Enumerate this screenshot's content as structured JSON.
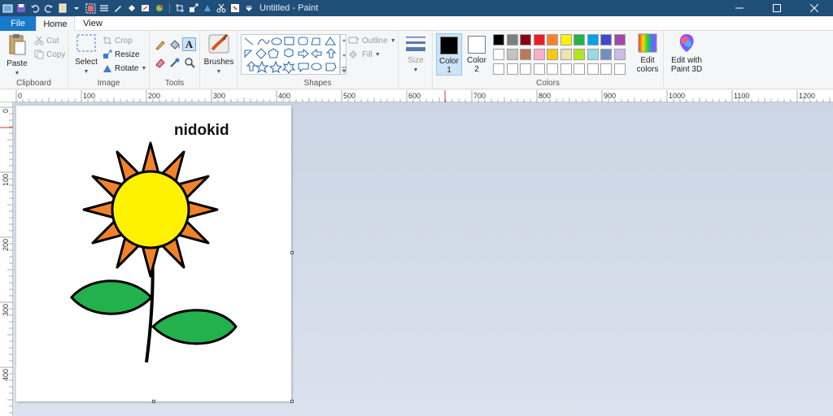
{
  "titlebar": {
    "title": "Untitled - Paint",
    "quick_access": [
      "app-icon",
      "save-icon",
      "undo-icon",
      "redo-icon",
      "clipboard-icon",
      "dropdown-icon",
      "select-icon",
      "size-icon",
      "pencil-icon",
      "fill-icon",
      "brush-icon",
      "paint3d-icon",
      "crop-icon",
      "resize-icon",
      "rotate-icon",
      "cut-icon",
      "color-picker-icon",
      "customize-icon"
    ]
  },
  "tabs": {
    "file": "File",
    "home": "Home",
    "view": "View"
  },
  "ribbon": {
    "clipboard": {
      "label": "Clipboard",
      "paste": "Paste",
      "cut": "Cut",
      "copy": "Copy"
    },
    "image": {
      "label": "Image",
      "select": "Select",
      "crop": "Crop",
      "resize": "Resize",
      "rotate": "Rotate"
    },
    "tools": {
      "label": "Tools",
      "brushes": "Brushes"
    },
    "shapes": {
      "label": "Shapes",
      "outline": "Outline",
      "fill": "Fill"
    },
    "size": {
      "label": "Size"
    },
    "colors": {
      "label": "Colors",
      "color1": "Color",
      "color1_num": "1",
      "color2": "Color",
      "color2_num": "2",
      "color1_value": "#000000",
      "color2_value": "#ffffff",
      "edit_colors_line1": "Edit",
      "edit_colors_line2": "colors",
      "palette_row1": [
        "#000000",
        "#7f7f7f",
        "#880015",
        "#ed1c24",
        "#ff7f27",
        "#fff200",
        "#22b14c",
        "#00a2e8",
        "#3f48cc",
        "#a349a4"
      ],
      "palette_row2": [
        "#ffffff",
        "#c3c3c3",
        "#b97a57",
        "#ffaec9",
        "#ffc90e",
        "#efe4b0",
        "#b5e61d",
        "#99d9ea",
        "#7092be",
        "#c8bfe7"
      ]
    },
    "paint3d": {
      "line1": "Edit with",
      "line2": "Paint 3D"
    }
  },
  "ruler": {
    "top_labels": [
      "0",
      "100",
      "200",
      "300",
      "400",
      "500",
      "600",
      "700",
      "800",
      "900",
      "1000",
      "1100",
      "1200"
    ],
    "left_labels": [
      "0",
      "100",
      "200",
      "300",
      "400"
    ]
  },
  "canvas": {
    "text": "nidokid",
    "colors": {
      "petals": "#f0832a",
      "center": "#fff200",
      "leaves": "#22b14c",
      "stroke": "#000000"
    }
  }
}
